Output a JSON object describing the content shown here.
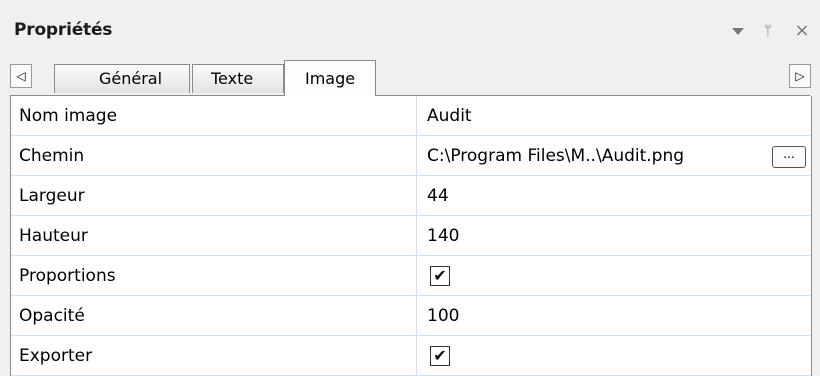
{
  "panel": {
    "title": "Propriétés",
    "buttons": {
      "dropdown_icon": "triangle-down",
      "pin_icon": "pin",
      "pin_glyph": "ᛘ",
      "close_glyph": "×"
    }
  },
  "tabs": {
    "scroll_left_glyph": "◁",
    "scroll_right_glyph": "▷",
    "items": [
      {
        "label": "Général",
        "active": false
      },
      {
        "label": "Texte",
        "active": false
      },
      {
        "label": "Image",
        "active": true
      }
    ]
  },
  "properties": [
    {
      "name": "Nom image",
      "value": "Audit"
    },
    {
      "name": "Chemin",
      "value": "C:\\Program Files\\M..\\Audit.png",
      "button": "..."
    },
    {
      "name": "Largeur",
      "value": "44"
    },
    {
      "name": "Hauteur",
      "value": "140"
    },
    {
      "name": "Proportions",
      "checked": true,
      "check_glyph": "✔"
    },
    {
      "name": "Opacité",
      "value": "100"
    },
    {
      "name": "Exporter",
      "checked": true,
      "check_glyph": "✔"
    }
  ],
  "colors": {
    "background": "#f0f0f0",
    "grid_line": "#cfe1f3",
    "border": "#8a8a8a"
  }
}
